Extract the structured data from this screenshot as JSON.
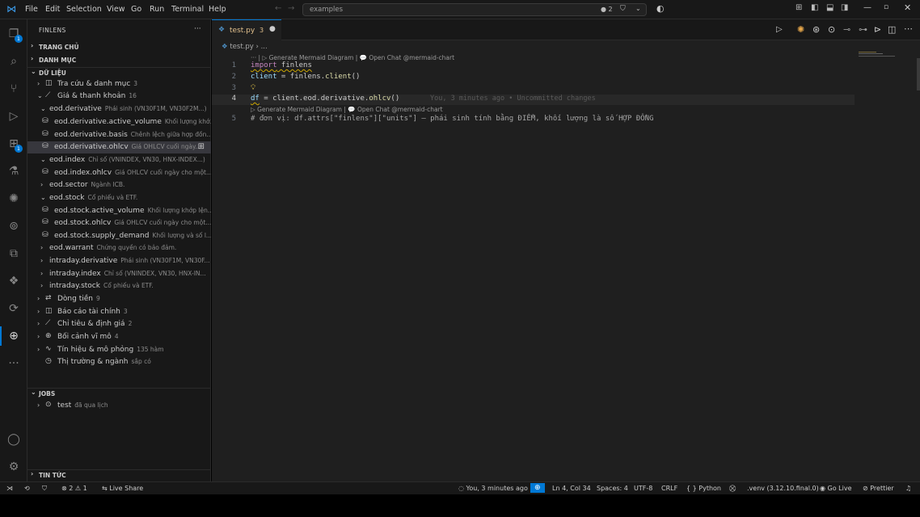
{
  "menu": [
    "File",
    "Edit",
    "Selection",
    "View",
    "Go",
    "Run",
    "Terminal",
    "Help"
  ],
  "search": {
    "text": "examples"
  },
  "title_status": {
    "dot_count": "2"
  },
  "activity_badges": {
    "explorer": "1",
    "extensions": "1"
  },
  "sidebar": {
    "title": "FINLENS",
    "more": "···",
    "sections": {
      "home": "TRANG CHỦ",
      "catalog": "DANH MỤC",
      "data": "DỮ LIỆU",
      "jobs": "JOBS",
      "news": "TIN TỨC"
    },
    "tree": [
      {
        "name": "Tra cứu & danh mục",
        "desc": "3"
      },
      {
        "name": "Giá & thanh khoản",
        "desc": "16"
      },
      {
        "name": "eod.derivative",
        "desc": "Phái sinh (VN30F1M, VN30F2M...)"
      },
      {
        "name": "eod.derivative.active_volume",
        "desc": "Khối lượng khớ..."
      },
      {
        "name": "eod.derivative.basis",
        "desc": "Chênh lệch giữa hợp đồn..."
      },
      {
        "name": "eod.derivative.ohlcv",
        "desc": "Giá OHLCV cuối ngày..."
      },
      {
        "name": "eod.index",
        "desc": "Chỉ số (VNINDEX, VN30, HNX-INDEX...)"
      },
      {
        "name": "eod.index.ohlcv",
        "desc": "Giá OHLCV cuối ngày cho một..."
      },
      {
        "name": "eod.sector",
        "desc": "Ngành ICB."
      },
      {
        "name": "eod.stock",
        "desc": "Cổ phiếu và ETF."
      },
      {
        "name": "eod.stock.active_volume",
        "desc": "Khối lượng khớp lện..."
      },
      {
        "name": "eod.stock.ohlcv",
        "desc": "Giá OHLCV cuối ngày cho một..."
      },
      {
        "name": "eod.stock.supply_demand",
        "desc": "Khối lượng và số l..."
      },
      {
        "name": "eod.warrant",
        "desc": "Chứng quyền có bảo đảm."
      },
      {
        "name": "intraday.derivative",
        "desc": "Phái sinh (VN30F1M, VN30F..."
      },
      {
        "name": "intraday.index",
        "desc": "Chỉ số (VNINDEX, VN30, HNX-IN..."
      },
      {
        "name": "intraday.stock",
        "desc": "Cổ phiếu và ETF."
      },
      {
        "name": "Dòng tiền",
        "desc": "9"
      },
      {
        "name": "Báo cáo tài chính",
        "desc": "3"
      },
      {
        "name": "Chỉ tiêu & định giá",
        "desc": "2"
      },
      {
        "name": "Bối cảnh vĩ mô",
        "desc": "4"
      },
      {
        "name": "Tín hiệu & mô phỏng",
        "desc": "135 hàm"
      },
      {
        "name": "Thị trường & ngành",
        "desc": "sắp có"
      }
    ],
    "jobs": [
      {
        "name": "test",
        "desc": "đã qua lịch"
      }
    ]
  },
  "editor": {
    "tab": {
      "name": "test.py",
      "problems": "3"
    },
    "breadcrumb": [
      "test.py",
      "..."
    ],
    "codelens_top": "··· | ▷ Generate Mermaid Diagram | 💬 Open Chat @mermaid-chart",
    "codelens_mid": "▷ Generate Mermaid Diagram | 💬 Open Chat @mermaid-chart",
    "lines": [
      {
        "n": "1",
        "a": "import",
        "b": " finlens"
      },
      {
        "n": "2",
        "a": "client",
        "b": " = finlens.",
        "c": "client",
        "d": "()"
      },
      {
        "n": "3"
      },
      {
        "n": "4",
        "a": "df",
        "b": " = client.eod.derivative.",
        "c": "ohlcv",
        "d": "()"
      },
      {
        "n": "5",
        "text": "# đơn vị: df.attrs[\"finlens\"][\"units\"] — phái sinh tính bằng ĐIỂM, khối lượng là số HỢP ĐỒNG"
      }
    ],
    "blame": "You, 3 minutes ago • Uncommitted changes"
  },
  "status": {
    "problems_errors": "2",
    "problems_warnings": "1",
    "live_share": "Live Share",
    "blame": "You, 3 minutes ago",
    "position": "Ln 4, Col 34",
    "spaces": "Spaces: 4",
    "encoding": "UTF-8",
    "eol": "CRLF",
    "language": "Python",
    "venv": ".venv (3.12.10.final.0)",
    "go_live": "Go Live",
    "prettier": "Prettier"
  },
  "colors": {
    "accent": "#0078d4",
    "bg": "#1f1f1f",
    "sidebar": "#181818"
  }
}
